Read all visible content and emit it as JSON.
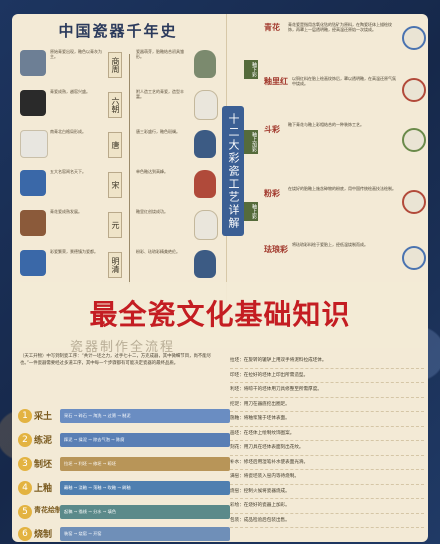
{
  "timeline": {
    "title": "中国瓷器千年史",
    "rows": [
      {
        "dynasty": "商周",
        "note": "原始青瓷出现，釉色以青灰为主。",
        "note2": "瓷器萌芽，胎釉结合初具雏形。"
      },
      {
        "dynasty": "六朝",
        "note": "青瓷成熟，越窑兴盛。",
        "note2": "附人造工艺的青瓷，造型丰富。"
      },
      {
        "dynasty": "唐",
        "note": "南青北白格局形成。",
        "note2": "唐三彩盛行，釉色斑斓。"
      },
      {
        "dynasty": "宋",
        "note": "五大名窑闻名天下。",
        "note2": "单色釉达到高峰。"
      },
      {
        "dynasty": "元",
        "note": "青花瓷成熟发展。",
        "note2": "釉里红创烧成功。"
      },
      {
        "dynasty": "明清",
        "note": "彩瓷繁荣，景德镇为瓷都。",
        "note2": "粉彩、珐琅彩精美绝伦。"
      }
    ]
  },
  "center_title": "十二大彩瓷工艺详解",
  "right": {
    "cat1": "青花",
    "cat2": "釉里红",
    "cat3": "斗彩",
    "cat4": "粉彩",
    "cat5": "珐琅彩",
    "tag1": "釉下彩",
    "tag2": "釉上加彩",
    "tag3": "釉上彩",
    "text1": "青花瓷是指用含氧化钴的钴矿为原料，在陶瓷坯体上描绘纹饰，再罩上一层透明釉，经高温还原焰一次烧成。",
    "text2": "以铜红料在胎上绘画纹饰后，罩以透明釉，在高温还原气氛中烧成。",
    "text3": "釉下青花与釉上彩相结合的一种装饰工艺。",
    "text4": "在烧好的胎釉上施含砷物的粉底，用中国传统绘画技法绘制。",
    "text5": "将珐琅彩料绘于瓷胎上，经低温烧制而成。"
  },
  "headline": "最全瓷文化基础知识",
  "process": {
    "title": "瓷器制作全流程",
    "intro": "（天工开物）中写到制瓷工序：“共计一坯之力，过手七十二，方克成器，其中微细节目，尚不能尽也。”一件瓷器需要经过多道工序，其中每一个步骤都有可能决定瓷器的最终品质。",
    "steps": [
      {
        "n": "1",
        "name": "采土",
        "color": "#6a8dc2",
        "text": "采石 → 碎石 → 淘洗 → 过筛 → 制泥"
      },
      {
        "n": "2",
        "name": "练泥",
        "color": "#5a7fb5",
        "text": "踩泥 → 揉泥 → 除去气泡 → 陈腐"
      },
      {
        "n": "3",
        "name": "制坯",
        "color": "#b89558",
        "text": "拉坯 → 利坯 → 修坯 → 晾坯"
      },
      {
        "n": "4",
        "name": "上釉",
        "color": "#4f7fb0",
        "text": "蘸釉 → 浇釉 → 荡釉 → 吹釉 → 刷釉"
      },
      {
        "n": "5",
        "name": "青花绘制",
        "color": "#5b8a8a",
        "text": "起稿 → 描线 → 分水 → 填色"
      },
      {
        "n": "6",
        "name": "烧制",
        "color": "#6f8fb8",
        "text": "装窑 → 烧窑 → 开窑"
      }
    ],
    "defs": [
      "拉坯：在旋转的辘轳上用双手将泥料拉成坯体。",
      "印坯：在拉好的坯体上印出所需造型。",
      "利坯：将晾干的坯体用刀具修整至所需厚度。",
      "挖足：用刀在器底挖出圈足。",
      "施釉：将釉浆施于坯体表面。",
      "画坯：在坯体上绘制纹饰图案。",
      "刻花：用刀具在坯体表面刻出花纹。",
      "补水：修坯后用湿笔补水使表面光滑。",
      "满窑：将瓷坯装入窑内等待烧制。",
      "烧窑：控制火候将瓷器烧成。",
      "彩绘：在烧好的瓷器上加彩。",
      "包装：成品检验后包装出售。"
    ]
  }
}
